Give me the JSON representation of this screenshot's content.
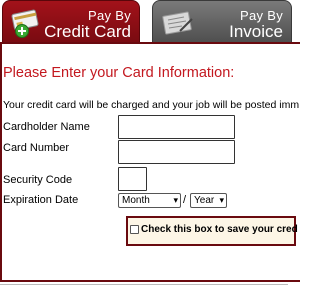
{
  "tabs": {
    "credit": {
      "line1": "Pay By",
      "line2": "Credit Card",
      "icon": "credit-card-add-icon",
      "active": true
    },
    "invoice": {
      "line1": "Pay By",
      "line2": "Invoice",
      "icon": "invoice-check-icon",
      "active": false
    }
  },
  "colors": {
    "accent": "#c3181f",
    "tab_active": "#8e0f15",
    "tab_inactive": "#666666",
    "border": "#6a0a0f"
  },
  "form": {
    "heading": "Please Enter your Card Information:",
    "notice": "Your credit card will be charged and your job will be posted imm",
    "fields": {
      "cardholder_label": "Cardholder Name",
      "cardholder_value": "",
      "card_number_label": "Card Number",
      "card_number_value": "",
      "security_code_label": "Security Code",
      "security_code_value": "",
      "expiration_label": "Expiration Date",
      "month_selected": "Month",
      "separator": "/",
      "year_selected": "Year"
    },
    "save": {
      "label": "Check this box to save your cred",
      "checked": false
    }
  }
}
